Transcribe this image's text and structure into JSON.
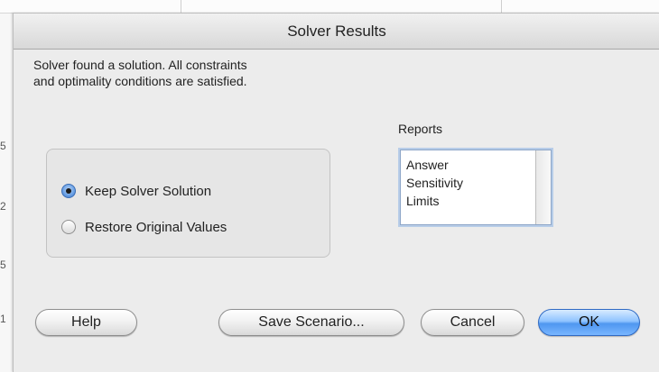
{
  "background": {
    "row_numbers": [
      "5",
      "2",
      "5",
      "1"
    ]
  },
  "dialog": {
    "title": "Solver Results",
    "message_line1": "Solver found a solution.  All constraints",
    "message_line2": "and optimality conditions are satisfied.",
    "options": [
      {
        "label": "Keep Solver Solution",
        "selected": true
      },
      {
        "label": "Restore Original Values",
        "selected": false
      }
    ],
    "reports": {
      "label": "Reports",
      "items": [
        "Answer",
        "Sensitivity",
        "Limits"
      ]
    },
    "buttons": {
      "help": "Help",
      "save_scenario": "Save Scenario...",
      "cancel": "Cancel",
      "ok": "OK"
    }
  },
  "colors": {
    "accent": "#4f97f0",
    "dialog_bg": "#ececec"
  }
}
